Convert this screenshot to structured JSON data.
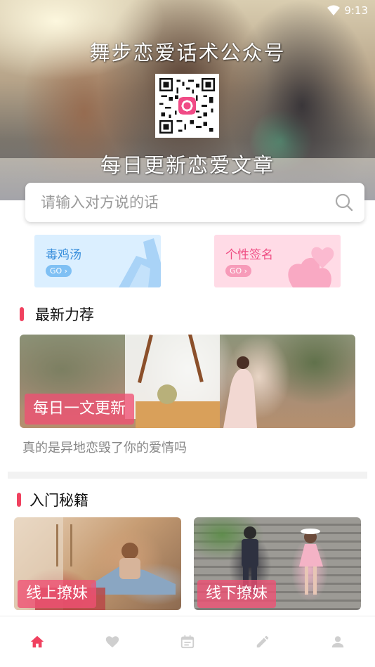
{
  "status_bar": {
    "time": "9:13",
    "wifi_icon": "wifi-icon"
  },
  "hero": {
    "title": "舞步恋爱话术公众号",
    "subtitle": "每日更新恋爱文章",
    "qr_icon": "qr-code-icon"
  },
  "search": {
    "placeholder": "请输入对方说的话",
    "value": "",
    "icon": "search-icon"
  },
  "categories": [
    {
      "label": "毒鸡汤",
      "go": "GO ›",
      "color": "#3a8fdc"
    },
    {
      "label": "个性签名",
      "go": "GO ›",
      "color": "#ef4d83"
    }
  ],
  "latest": {
    "title": "最新力荐",
    "banner_tag": "每日一文更新",
    "caption": "真的是异地恋毁了你的爱情吗"
  },
  "guides": {
    "title": "入门秘籍",
    "items": [
      {
        "label": "线上撩妹"
      },
      {
        "label": "线下撩妹"
      }
    ]
  },
  "tabbar": {
    "items": [
      {
        "icon": "home-icon",
        "active": true
      },
      {
        "icon": "heart-icon",
        "active": false
      },
      {
        "icon": "calendar-icon",
        "active": false
      },
      {
        "icon": "pencil-icon",
        "active": false
      },
      {
        "icon": "user-icon",
        "active": false
      }
    ]
  },
  "colors": {
    "accent": "#f0415f",
    "tab_active": "#f0415f",
    "tab_inactive": "#cfcfcf"
  }
}
